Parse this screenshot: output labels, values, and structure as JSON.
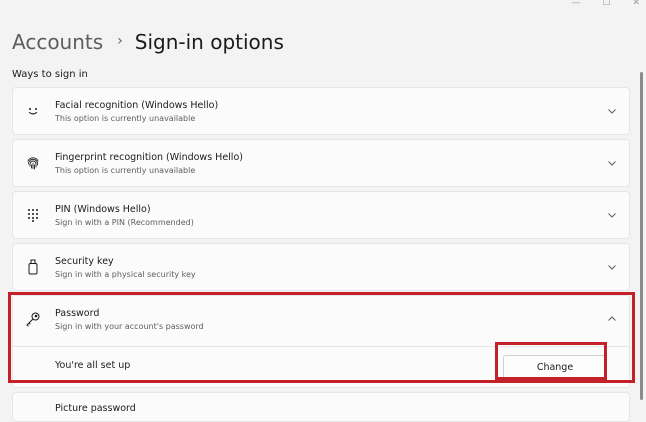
{
  "breadcrumb": {
    "parent": "Accounts",
    "separator": "›",
    "current": "Sign-in options"
  },
  "section_label": "Ways to sign in",
  "options": [
    {
      "title": "Facial recognition (Windows Hello)",
      "subtitle": "This option is currently unavailable",
      "icon": "smiley-face-icon"
    },
    {
      "title": "Fingerprint recognition (Windows Hello)",
      "subtitle": "This option is currently unavailable",
      "icon": "fingerprint-icon"
    },
    {
      "title": "PIN (Windows Hello)",
      "subtitle": "Sign in with a PIN (Recommended)",
      "icon": "keypad-icon"
    },
    {
      "title": "Security key",
      "subtitle": "Sign in with a physical security key",
      "icon": "usb-key-icon"
    }
  ],
  "password": {
    "title": "Password",
    "subtitle": "Sign in with your account's password",
    "icon": "key-icon",
    "status": "You're all set up",
    "change_label": "Change"
  },
  "partial_option": {
    "title": "Picture password"
  },
  "colors": {
    "highlight": "#c3202a",
    "card_bg": "#fbfbfb",
    "page_bg": "#f3f3f3"
  }
}
